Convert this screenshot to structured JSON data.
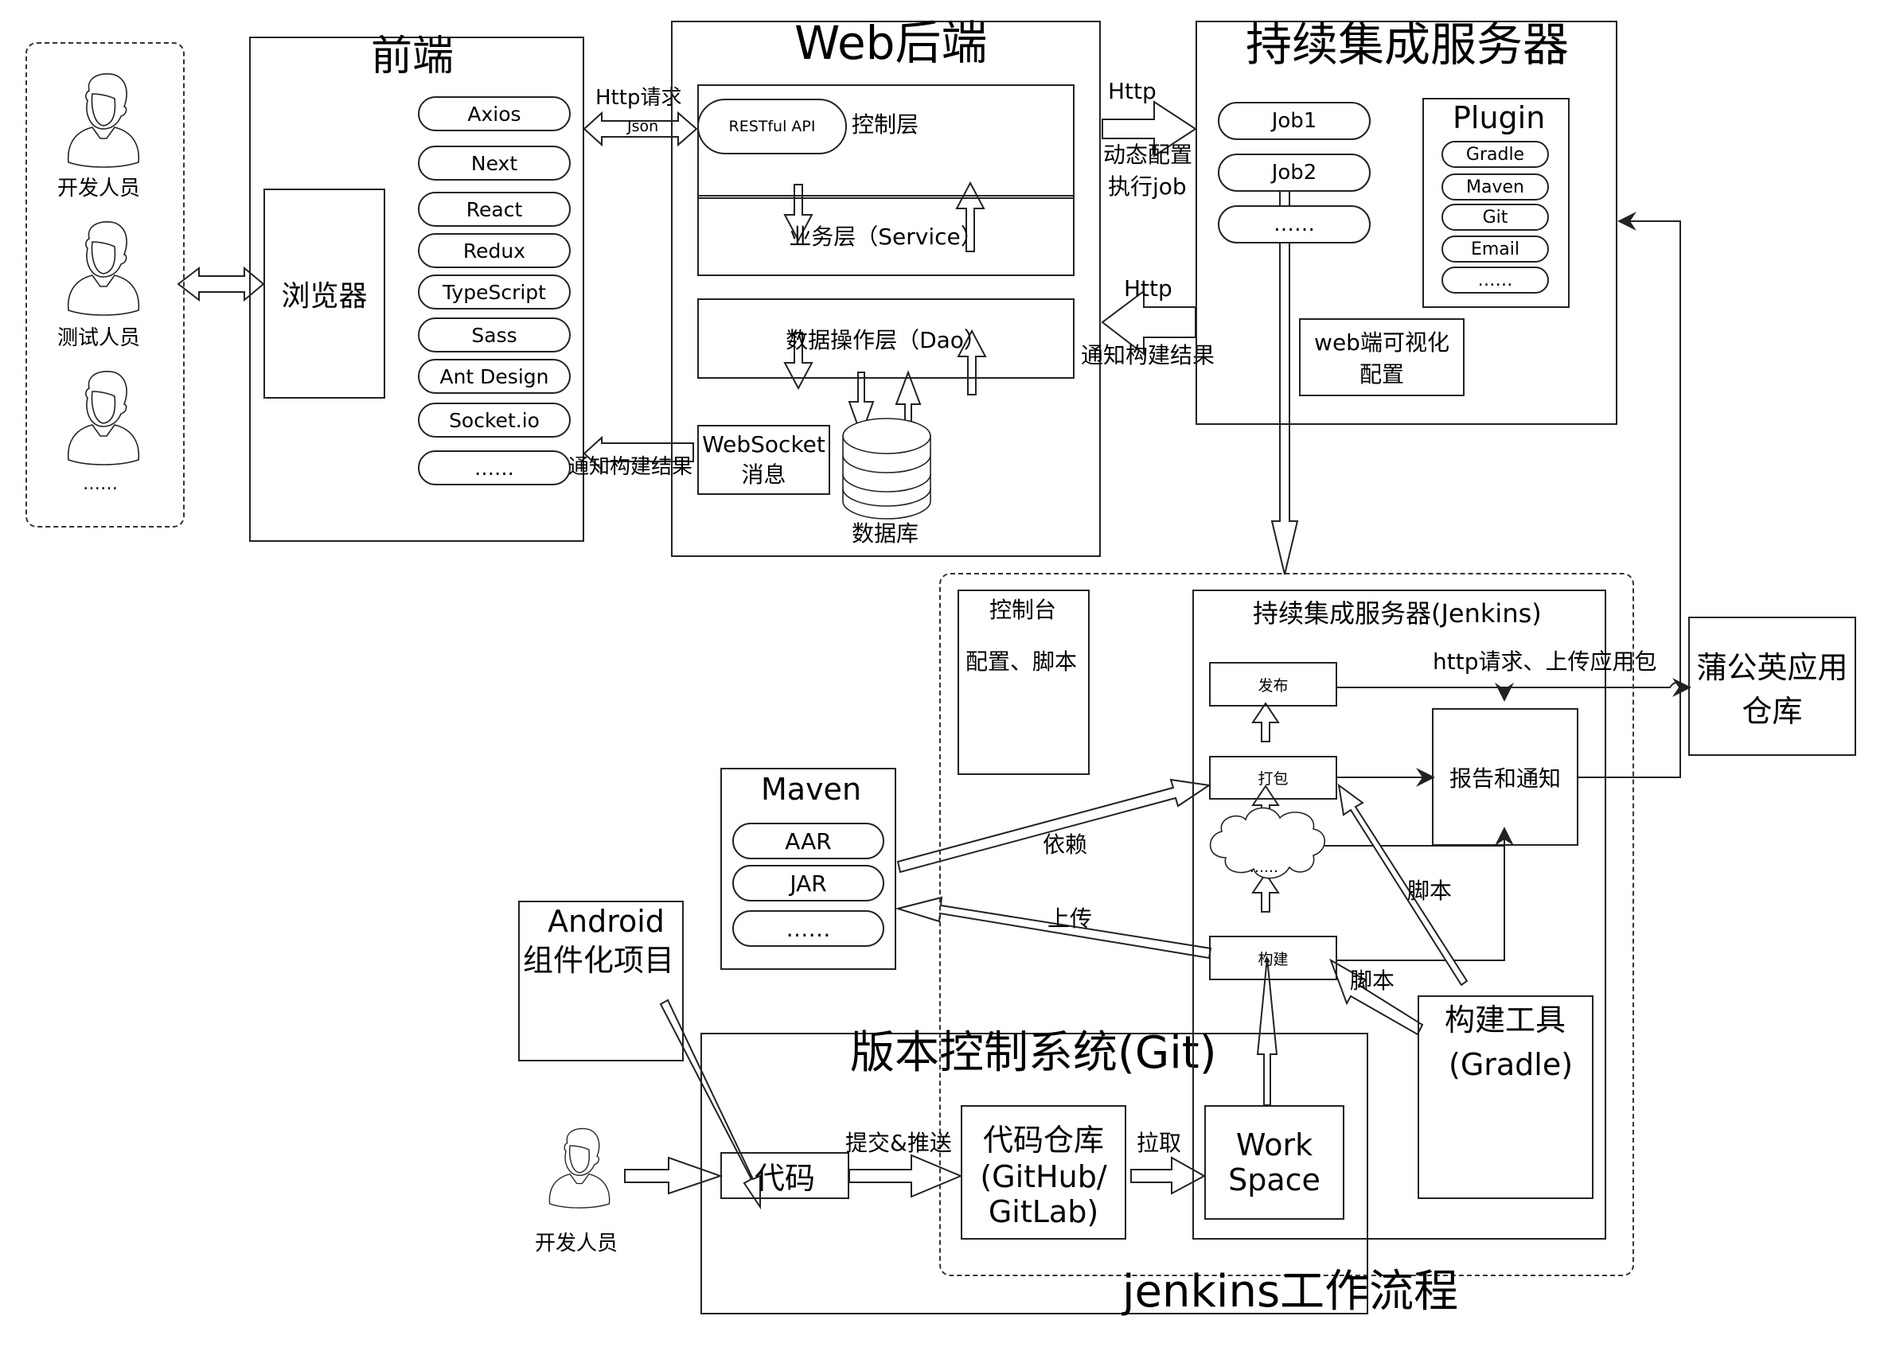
{
  "users": {
    "items": [
      "开发人员",
      "测试人员",
      "……"
    ]
  },
  "frontend": {
    "title": "前端",
    "browser": "浏览器",
    "pills": [
      "Axios",
      "Next",
      "React",
      "Redux",
      "TypeScript",
      "Sass",
      "Ant Design",
      "Socket.io",
      "……"
    ]
  },
  "links": {
    "http_request": "Http请求",
    "json": "Json",
    "notify_result_ws": "通知构建结果",
    "http_out": "Http",
    "dynamic_config": "动态配置",
    "exec_job": "执行job",
    "http_in": "Http",
    "notify_result_ci": "通知构建结果"
  },
  "backend": {
    "title": "Web后端",
    "restful": "RESTful API",
    "controller": "控制层",
    "service": "业务层（Service）",
    "dao": "数据操作层（Dao）",
    "websocket": "WebSocket",
    "websocket_sub": "消息",
    "database": "数据库"
  },
  "ci_server": {
    "title": "持续集成服务器",
    "jobs": [
      "Job1",
      "Job2",
      "……"
    ],
    "plugin_title": "Plugin",
    "plugins": [
      "Gradle",
      "Maven",
      "Git",
      "Email",
      "……"
    ],
    "web_config": "web端可视化",
    "web_config_2": "配置"
  },
  "workflow": {
    "title": "jenkins工作流程",
    "console_title": "控制台",
    "console_sub": "配置、脚本",
    "jenkins_title": "持续集成服务器(Jenkins)",
    "publish": "发布",
    "package": "打包",
    "cloud": "……",
    "build": "构建",
    "report": "报告和通知",
    "http_upload": "http请求、上传应用包",
    "script_1": "脚本",
    "script_2": "脚本",
    "build_tool": "构建工具",
    "build_tool_sub": "(Gradle)",
    "pgyer": "蒲公英应用",
    "pgyer_2": "仓库",
    "maven_title": "Maven",
    "maven_items": [
      "AAR",
      "JAR",
      "……"
    ],
    "depend": "依赖",
    "upload": "上传",
    "android": "Android",
    "android_2": "组件化项目",
    "vcs_title": "版本控制系统(Git)",
    "code": "代码",
    "commit_push": "提交&推送",
    "repo": "代码仓库",
    "repo_2": "(GitHub/",
    "repo_3": "GitLab)",
    "pull": "拉取",
    "workspace": "Work",
    "workspace_2": "Space",
    "developer": "开发人员"
  }
}
